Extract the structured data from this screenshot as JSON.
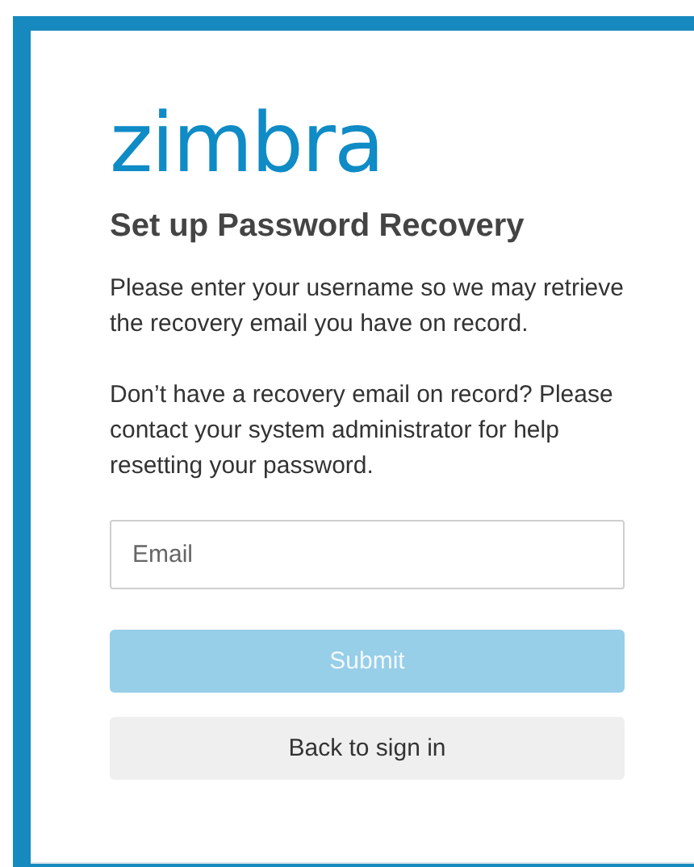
{
  "logo": "zimbra",
  "title": "Set up Password Recovery",
  "paragraphs": [
    "Please enter your username so we may retrieve the recovery email you have on record.",
    "Don’t have a recovery email on record? Please contact your system administrator for help resetting your password."
  ],
  "email_field": {
    "placeholder": "Email"
  },
  "buttons": [
    {
      "label": "Submit",
      "kind": "primary",
      "disabled": true
    },
    {
      "label": "Back to sign in",
      "kind": "secondary",
      "disabled": false
    }
  ]
}
